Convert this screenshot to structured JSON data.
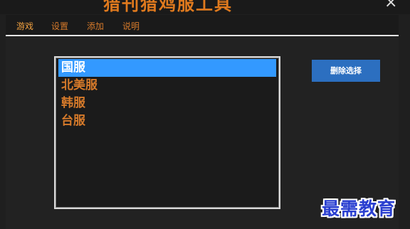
{
  "window": {
    "title": "猎刊猎鸡服工具",
    "close_glyph": "×"
  },
  "menu": {
    "items": [
      {
        "label": "游戏",
        "active": true
      },
      {
        "label": "设置"
      },
      {
        "label": "添加"
      },
      {
        "label": "说明"
      }
    ]
  },
  "server_list": {
    "items": [
      {
        "label": "国服",
        "selected": true
      },
      {
        "label": "北美服"
      },
      {
        "label": "韩服"
      },
      {
        "label": "台服"
      }
    ]
  },
  "actions": {
    "delete_label": "删除选择"
  },
  "watermark": {
    "text": "最需教育"
  },
  "colors": {
    "accent_orange": "#d67a2a",
    "selection_blue": "#3399ff",
    "button_blue": "#2c6fc0",
    "background": "#1f1f1f"
  }
}
